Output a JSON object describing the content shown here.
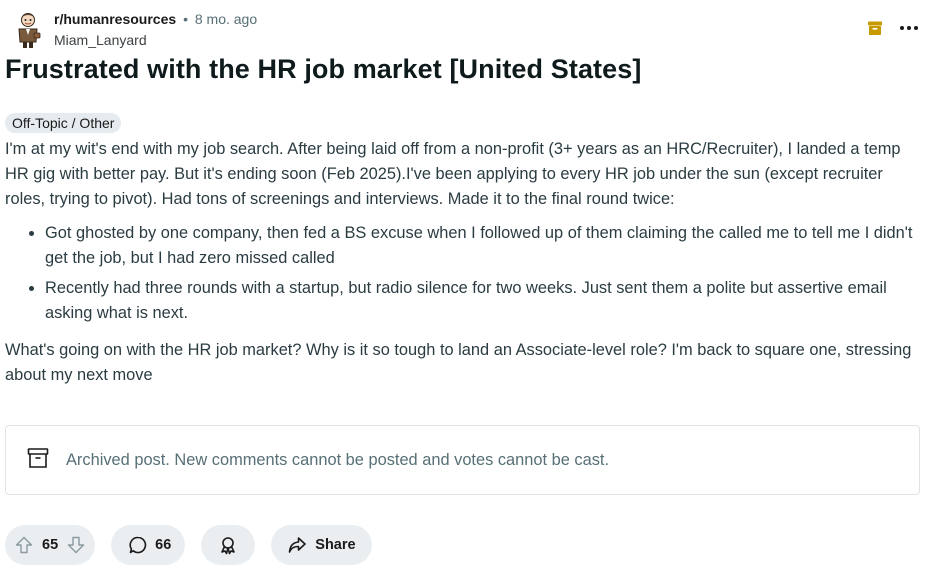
{
  "post": {
    "subreddit": "r/humanresources",
    "separator": "•",
    "age": "8 mo. ago",
    "author": "Miam_Lanyard",
    "title": "Frustrated with the HR job market [United States]",
    "flair": "Off-Topic / Other",
    "body": {
      "intro": "I'm at my wit's end with my job search. After being laid off from a non-profit (3+ years as an HRC/Recruiter), I landed a temp HR gig with better pay. But it's ending soon (Feb 2025).I've been applying to every HR job under the sun (except recruiter roles, trying to pivot). Had tons of screenings and interviews. Made it to the final round twice:",
      "bullets": [
        "Got ghosted by one company, then fed a BS excuse when I followed up of them claiming the called me to tell me I didn't get the job, but I had zero missed called",
        "Recently had three rounds with a startup, but radio silence for two weeks. Just sent them a polite but assertive email asking what is next."
      ],
      "outro": "What's going on with the HR job market? Why is it so tough to land an Associate-level role? I'm back to square one, stressing about my next move"
    },
    "archived_notice": "Archived post. New comments cannot be posted and votes cannot be cast."
  },
  "actions": {
    "votes": "65",
    "comments": "66",
    "share_label": "Share"
  },
  "icons": {
    "avatar": "subreddit-avatar-icon",
    "archive": "archive-icon",
    "more": "more-options-icon",
    "upvote": "upvote-icon",
    "downvote": "downvote-icon",
    "comment": "comment-icon",
    "award": "award-icon",
    "share": "share-icon"
  },
  "colors": {
    "archive_accent": "#c79a00",
    "pill_background": "#eaeef0",
    "flair_background": "#e5ebee",
    "muted_text": "#576f76"
  }
}
